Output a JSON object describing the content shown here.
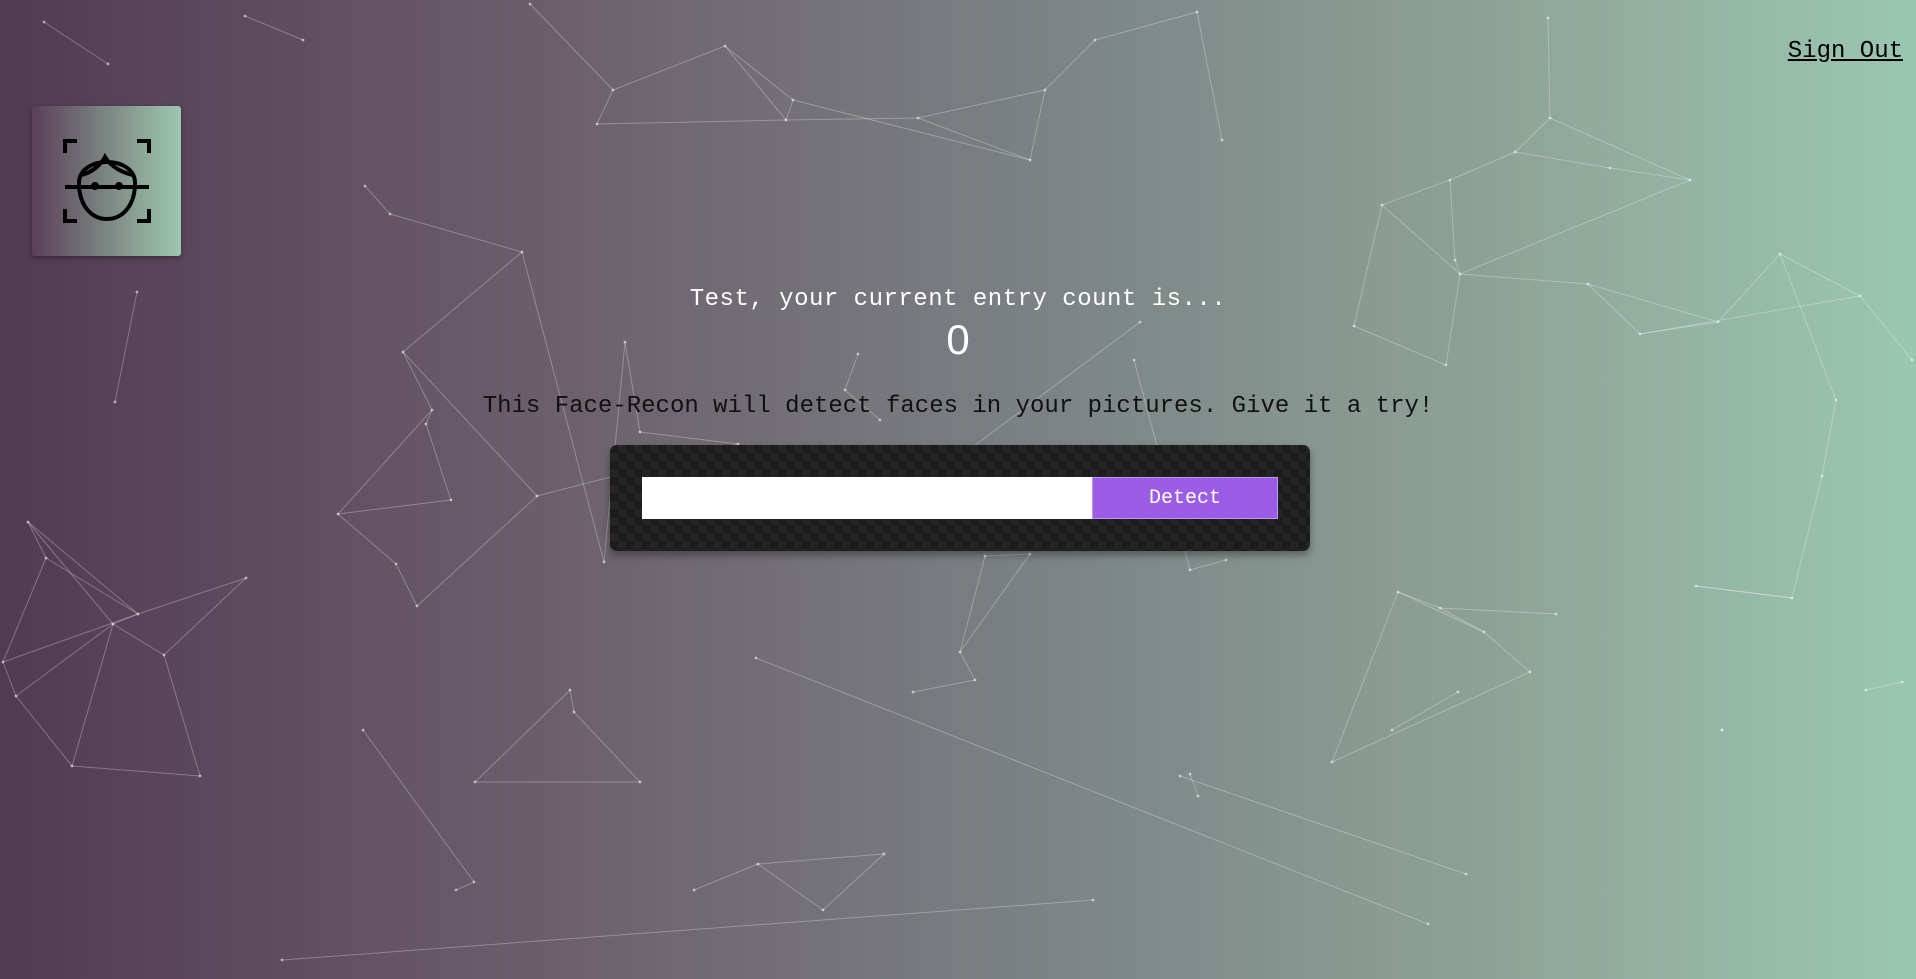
{
  "header": {
    "signout_label": "Sign Out"
  },
  "logo": {
    "icon": "face-scan-icon"
  },
  "main": {
    "greeting": "Test, your current entry count is...",
    "entry_count": "0",
    "description": "This Face-Recon will detect faces in your pictures. Give it a try!"
  },
  "form": {
    "input_value": "",
    "input_placeholder": "",
    "detect_label": "Detect"
  },
  "colors": {
    "gradient_left": "#523a52",
    "gradient_right": "#9bc7b2",
    "button_purple": "#9b5de5",
    "form_dark": "#1c1c1c"
  }
}
